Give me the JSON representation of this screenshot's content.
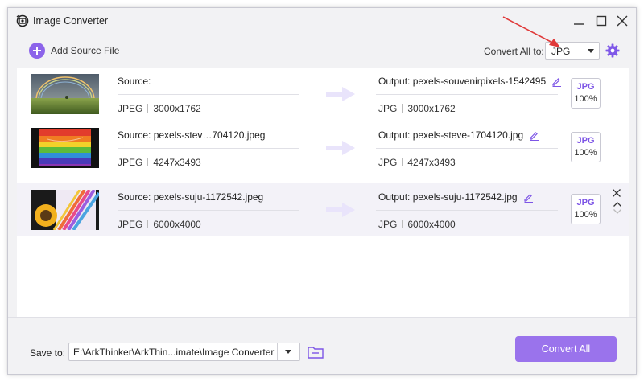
{
  "window": {
    "title": "Image Converter"
  },
  "toolbar": {
    "add_source_label": "Add Source File",
    "convert_all_to_label": "Convert All to:",
    "format_value": "JPG"
  },
  "files": [
    {
      "source_label": "Source:",
      "source_format": "JPEG",
      "source_dims": "3000x1762",
      "output_label": "Output: pexels-souvenirpixels-1542495",
      "output_format": "JPG",
      "output_dims": "3000x1762",
      "badge_format": "JPG",
      "badge_quality": "100%"
    },
    {
      "source_label": "Source: pexels-stev…704120.jpeg",
      "source_format": "JPEG",
      "source_dims": "4247x3493",
      "output_label": "Output: pexels-steve-1704120.jpg",
      "output_format": "JPG",
      "output_dims": "4247x3493",
      "badge_format": "JPG",
      "badge_quality": "100%"
    },
    {
      "source_label": "Source: pexels-suju-1172542.jpeg",
      "source_format": "JPEG",
      "source_dims": "6000x4000",
      "output_label": "Output: pexels-suju-1172542.jpg",
      "output_format": "JPG",
      "output_dims": "6000x4000",
      "badge_format": "JPG",
      "badge_quality": "100%"
    }
  ],
  "footer": {
    "save_to_label": "Save to:",
    "save_path": "E:\\ArkThinker\\ArkThin...imate\\Image Converter",
    "convert_all_label": "Convert All"
  },
  "colors": {
    "accent": "#8c64ea",
    "convert_button": "#9a73ec",
    "annotation_arrow": "#e03a3a"
  },
  "icons": {
    "app": "app-logo-icon",
    "minimize": "minimize-icon",
    "maximize": "maximize-icon",
    "close": "close-icon",
    "add": "plus-circle-icon",
    "settings": "gear-icon",
    "edit": "pencil-icon",
    "folder": "folder-icon",
    "arrow": "arrow-right-icon"
  }
}
